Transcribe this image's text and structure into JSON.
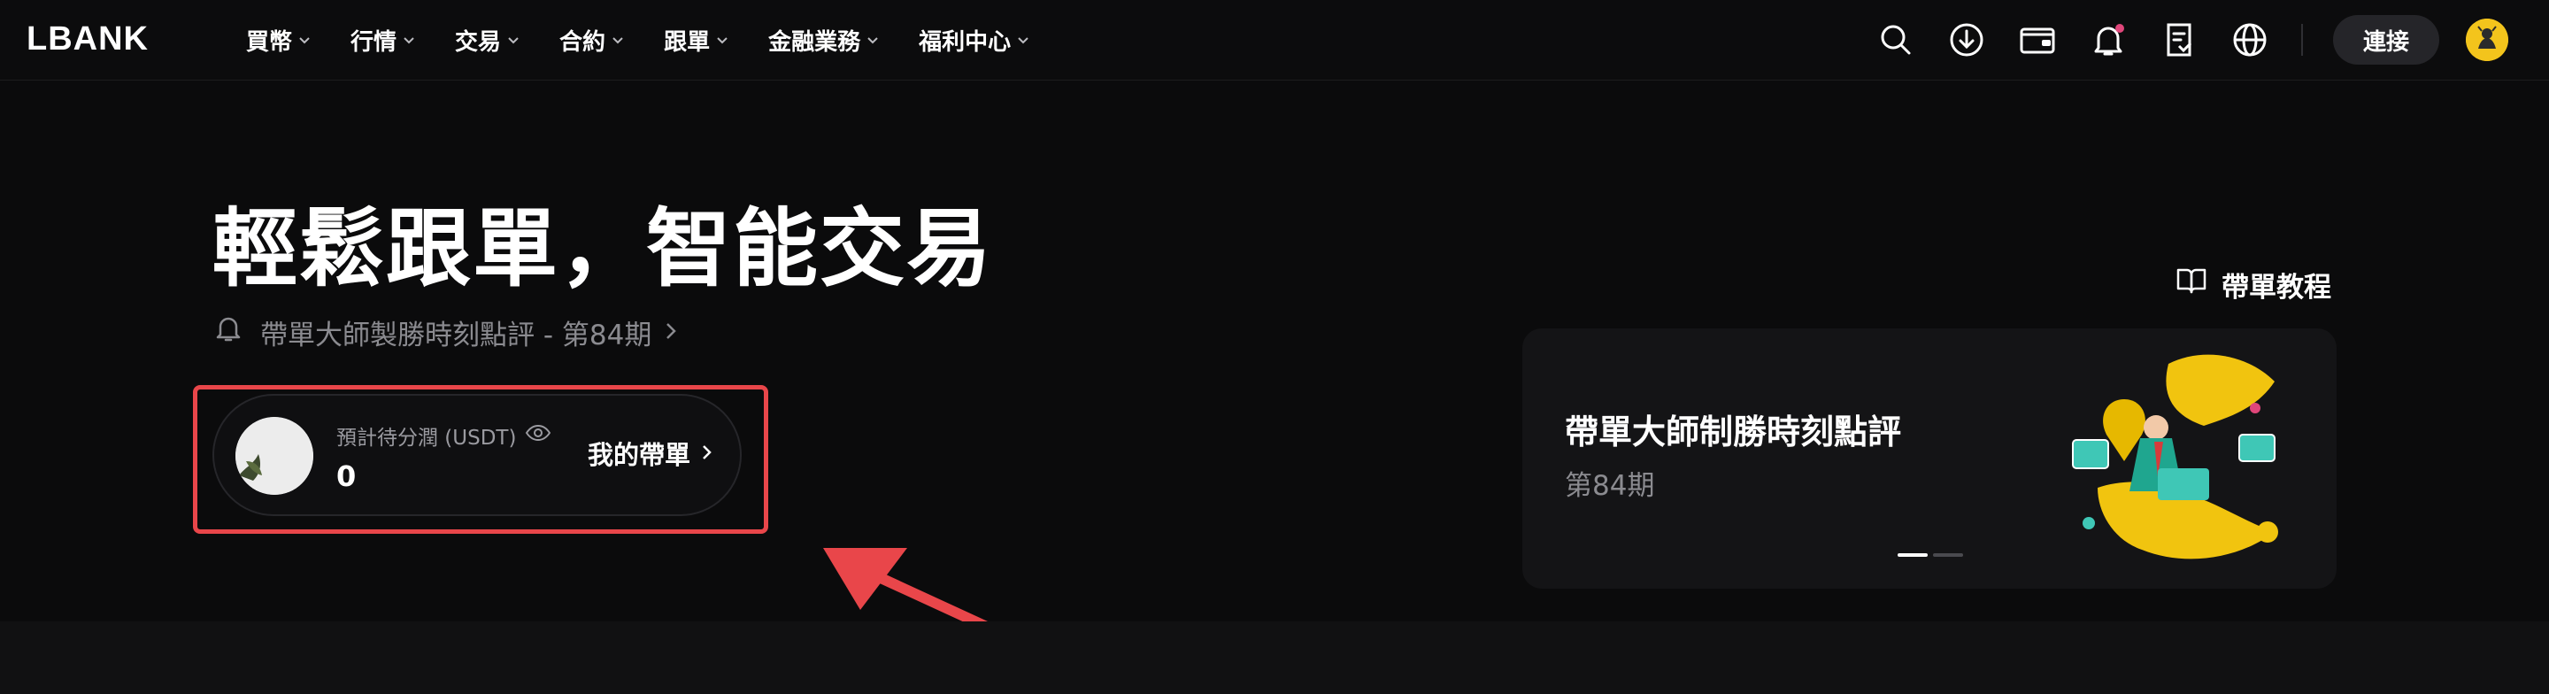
{
  "nav": {
    "logo": "LBANK",
    "items": [
      {
        "label": "買幣"
      },
      {
        "label": "行情"
      },
      {
        "label": "交易"
      },
      {
        "label": "合約"
      },
      {
        "label": "跟單"
      },
      {
        "label": "金融業務"
      },
      {
        "label": "福利中心"
      }
    ],
    "connect_label": "連接",
    "icons": [
      "search-icon",
      "download-icon",
      "wallet-icon",
      "bell-icon",
      "orders-icon",
      "globe-icon"
    ],
    "notification_dot_color": "#e0467a"
  },
  "hero": {
    "title": "輕鬆跟單，智能交易",
    "announcement": "帶單大師製勝時刻點評 - 第84期",
    "earnings": {
      "label": "預計待分潤 (USDT)",
      "value": "0",
      "link_label": "我的帶單"
    },
    "tutorial_label": "帶單教程",
    "banner": {
      "title": "帶單大師制勝時刻點評",
      "subtitle": "第84期",
      "active_slide": 1,
      "slide_count": 2
    }
  },
  "colors": {
    "background": "#0b0b0c",
    "highlight": "#e9464a",
    "accent_yellow": "#f3c41c",
    "muted_text": "#8b8b90"
  }
}
